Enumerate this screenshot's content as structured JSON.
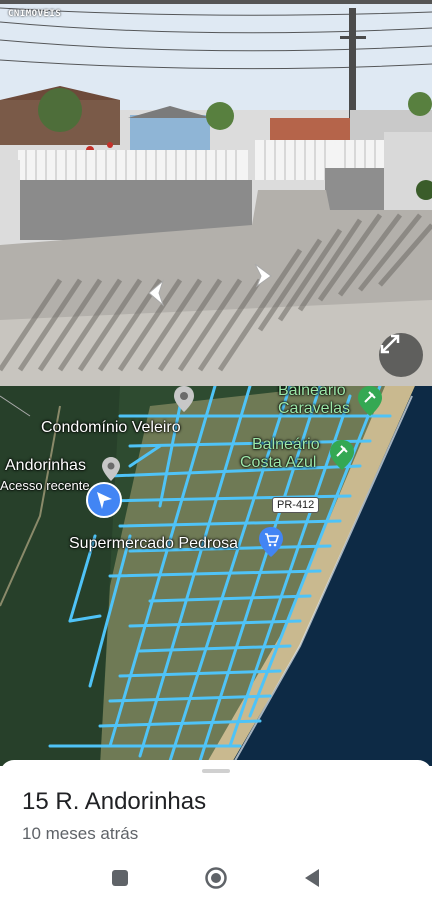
{
  "street_view": {
    "watermark": "CNIMOVEIS",
    "nav_left_icon": "chevron-left-icon",
    "nav_right_icon": "chevron-right-icon",
    "expand_icon": "expand-icon"
  },
  "map": {
    "labels": {
      "balneario_caravelas": [
        "Balneário",
        "Caravelas"
      ],
      "balneario_costa_azul": [
        "Balneário",
        "Costa Azul"
      ],
      "condominio": "Condomínio Veleiro",
      "andorinhas": "Andorinhas",
      "acesso": "Acesso recente",
      "supermercado": "Supermercado Pedrosa"
    },
    "route_shield": "PR-412",
    "colors": {
      "streets": "#4fc3f7",
      "beach_pin": "#34a853",
      "shopping_pin": "#4285f4",
      "location_arrow": "#4285f4"
    }
  },
  "place": {
    "title": "15 R. Andorinhas",
    "subtitle": "10 meses atrás"
  },
  "navbar": {
    "recents_icon": "square-icon",
    "home_icon": "circle-icon",
    "back_icon": "triangle-back-icon"
  }
}
